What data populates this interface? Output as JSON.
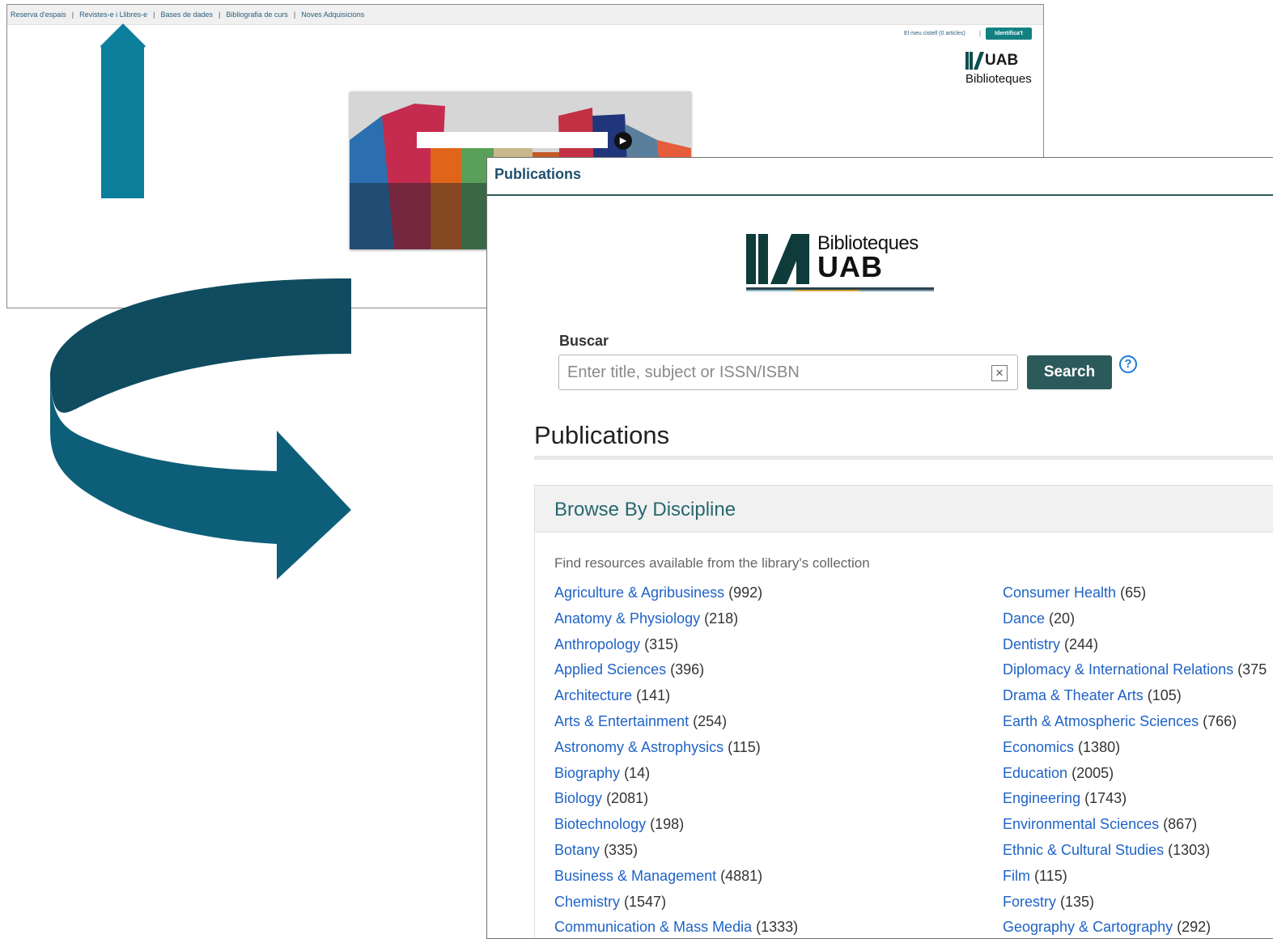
{
  "back_window": {
    "nav": [
      "Reserva d'espais",
      "Revistes-e i Llibres-e",
      "Bases de dades",
      "Bibliografia de curs",
      "Noves Adquisicions"
    ],
    "nav_separator": "|",
    "basket": "El meu cistell (0 articles)",
    "basket_separator": "|",
    "login_button": "Identifica't",
    "logo": {
      "mark": "UAB",
      "name": "Biblioteques"
    }
  },
  "front_window": {
    "header_title": "Publications",
    "logo": {
      "name": "Biblioteques",
      "mark": "UAB"
    },
    "search": {
      "label": "Buscar",
      "placeholder": "Enter title, subject or ISSN/ISBN",
      "clear_icon": "×",
      "button": "Search",
      "help_icon": "?"
    },
    "page_heading": "Publications",
    "discipline": {
      "heading": "Browse By Discipline",
      "description": "Find resources available from the library's collection",
      "left": [
        {
          "name": "Agriculture & Agribusiness",
          "count": "(992)"
        },
        {
          "name": "Anatomy & Physiology",
          "count": "(218)"
        },
        {
          "name": "Anthropology",
          "count": "(315)"
        },
        {
          "name": "Applied Sciences",
          "count": "(396)"
        },
        {
          "name": "Architecture",
          "count": "(141)"
        },
        {
          "name": "Arts & Entertainment",
          "count": "(254)"
        },
        {
          "name": "Astronomy & Astrophysics",
          "count": "(115)"
        },
        {
          "name": "Biography",
          "count": "(14)"
        },
        {
          "name": "Biology",
          "count": "(2081)"
        },
        {
          "name": "Biotechnology",
          "count": "(198)"
        },
        {
          "name": "Botany",
          "count": "(335)"
        },
        {
          "name": "Business & Management",
          "count": "(4881)"
        },
        {
          "name": "Chemistry",
          "count": "(1547)"
        },
        {
          "name": "Communication & Mass Media",
          "count": "(1333)"
        }
      ],
      "right": [
        {
          "name": "Consumer Health",
          "count": "(65)"
        },
        {
          "name": "Dance",
          "count": "(20)"
        },
        {
          "name": "Dentistry",
          "count": "(244)"
        },
        {
          "name": "Diplomacy & International Relations",
          "count": "(375"
        },
        {
          "name": "Drama & Theater Arts",
          "count": "(105)"
        },
        {
          "name": "Earth & Atmospheric Sciences",
          "count": "(766)"
        },
        {
          "name": "Economics",
          "count": "(1380)"
        },
        {
          "name": "Education",
          "count": "(2005)"
        },
        {
          "name": "Engineering",
          "count": "(1743)"
        },
        {
          "name": "Environmental Sciences",
          "count": "(867)"
        },
        {
          "name": "Ethnic & Cultural Studies",
          "count": "(1303)"
        },
        {
          "name": "Film",
          "count": "(115)"
        },
        {
          "name": "Forestry",
          "count": "(135)"
        },
        {
          "name": "Geography & Cartography",
          "count": "(292)"
        }
      ]
    }
  },
  "colors": {
    "arrow_up": "#0b7f9c",
    "curve_dark": "#0f4c60",
    "curve_light": "#0d5f79",
    "accent_teal": "#2c5a5b",
    "link_blue": "#1f63c6"
  }
}
